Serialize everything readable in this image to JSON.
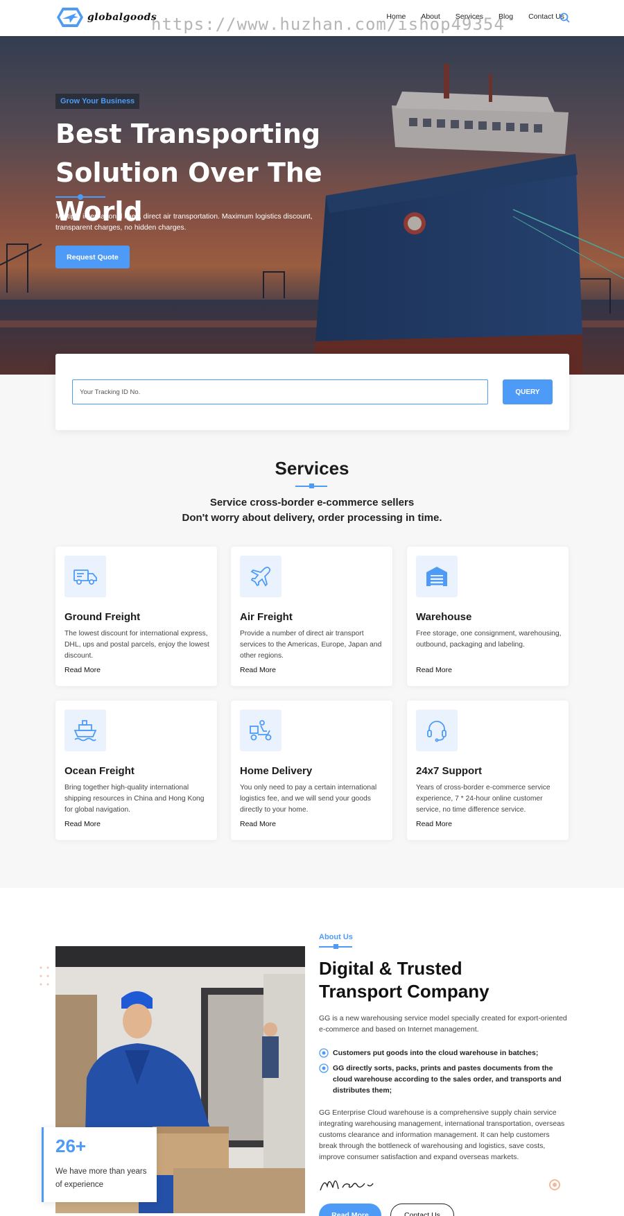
{
  "header": {
    "logo_text": "globalgoods",
    "nav": [
      "Home",
      "About",
      "Services",
      "Blog",
      "Contact Us"
    ],
    "watermark": "https://www.huzhan.com/ishop49354"
  },
  "hero": {
    "tag": "Grow Your Business",
    "title_line1": "Best Transporting",
    "title_line2": "Solution Over The World",
    "description": "Multiple international lines, direct air transportation. Maximum logistics discount, transparent charges, no hidden charges.",
    "button": "Request Quote"
  },
  "tracking": {
    "placeholder": "Your Tracking ID No.",
    "button": "QUERY"
  },
  "services": {
    "title": "Services",
    "subtitle_line1": "Service cross-border e-commerce sellers",
    "subtitle_line2": "Don't worry about delivery, order processing in time.",
    "cards": [
      {
        "icon": "truck-icon",
        "title": "Ground Freight",
        "desc": "The lowest discount for international express, DHL, ups and postal parcels, enjoy the lowest discount.",
        "more": "Read More"
      },
      {
        "icon": "plane-icon",
        "title": "Air Freight",
        "desc": "Provide a number of direct air transport services to the Americas, Europe, Japan and other regions.",
        "more": "Read More"
      },
      {
        "icon": "warehouse-icon",
        "title": "Warehouse",
        "desc": "Free storage, one consignment, warehousing, outbound, packaging and labeling.",
        "more": "Read More"
      },
      {
        "icon": "ship-icon",
        "title": "Ocean Freight",
        "desc": "Bring together high-quality international shipping resources in China and Hong Kong for global navigation.",
        "more": "Read More"
      },
      {
        "icon": "scooter-icon",
        "title": "Home Delivery",
        "desc": "You only need to pay a certain international logistics fee, and we will send your goods directly to your home.",
        "more": "Read More"
      },
      {
        "icon": "headset-icon",
        "title": "24x7 Support",
        "desc": "Years of cross-border e-commerce service experience, 7 * 24-hour online customer service, no time difference service.",
        "more": "Read More"
      }
    ]
  },
  "about": {
    "tag": "About Us",
    "title": "Digital & Trusted Transport Company",
    "intro": "GG is a new warehousing service model specially created for export-oriented e-commerce and based on Internet management.",
    "checks": [
      "Customers put goods into the cloud warehouse in batches;",
      "GG directly sorts, packs, prints and pastes documents from the cloud warehouse according to the sales order, and transports and distributes them;"
    ],
    "body": "GG Enterprise Cloud warehouse is a comprehensive supply chain service integrating warehousing management, international transportation, overseas customs clearance and information management. It can help customers break through the bottleneck of warehousing and logistics, save costs, improve consumer satisfaction and expand overseas markets.",
    "experience_num": "26+",
    "experience_text": "We have more than years of experience",
    "button_primary": "Read More",
    "button_secondary": "Contact Us"
  },
  "colors": {
    "accent": "#4d9bf7",
    "dark": "#1b1b1b"
  }
}
